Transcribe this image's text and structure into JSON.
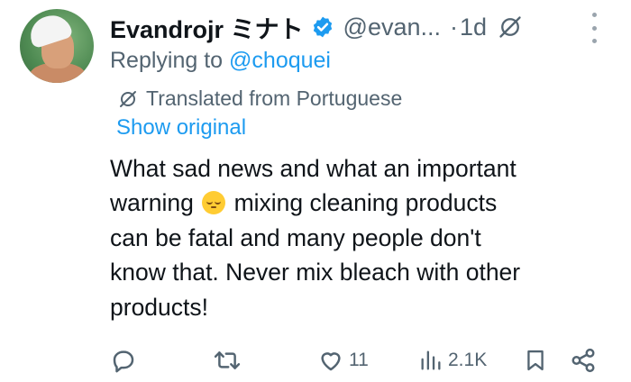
{
  "author": {
    "display_name": "Evandrojr ミナト",
    "handle": "@evan...",
    "separator": "·",
    "time": "1d",
    "verified": true
  },
  "reply": {
    "prefix": "Replying to ",
    "mention": "@choquei"
  },
  "translation": {
    "label": "Translated from Portuguese",
    "show_original": "Show original"
  },
  "tweet": {
    "line1": "What sad news and what an important",
    "line2a": "warning",
    "line2b": "mixing cleaning products",
    "line3": "can be fatal and many people don't",
    "line4": "know that. Never mix bleach with other",
    "line5": "products!",
    "emoji": "pensive-face"
  },
  "actions": {
    "reply_count": "",
    "retweet_count": "",
    "like_count": "11",
    "views_count": "2.1K"
  },
  "colors": {
    "text": "#0f1419",
    "secondary": "#536471",
    "link": "#1d9bf0",
    "verified": "#1d9bf0"
  }
}
